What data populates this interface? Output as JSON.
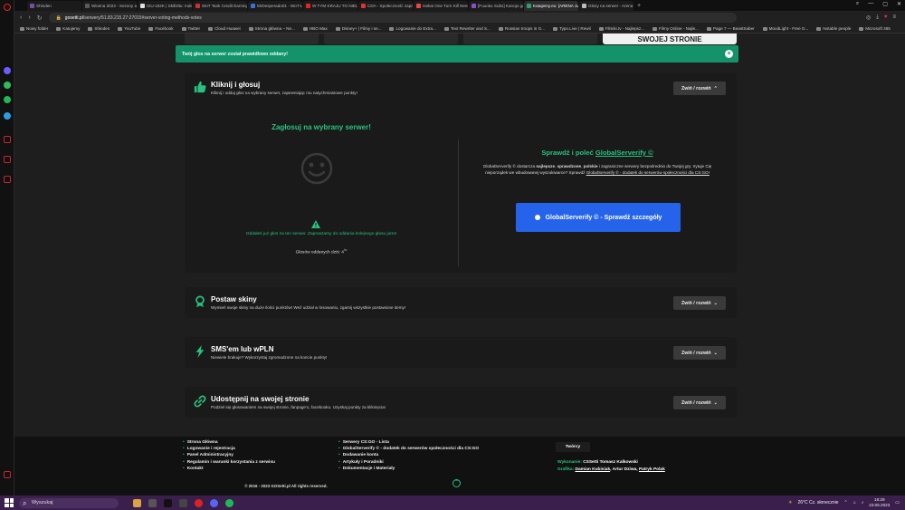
{
  "browser": {
    "tabs": [
      {
        "label": "Shinden",
        "color": "#7a4fa3"
      },
      {
        "label": "Wiosna 2023 - Sezony ani",
        "color": "#5a5a5a"
      },
      {
        "label": "ISU-152K | Skill4ltu: Index",
        "color": "#e0e0e0"
      },
      {
        "label": "WoT Tank Credit Earnings",
        "color": "#c83232"
      },
      {
        "label": "MrDesperado01 - WoT-Li",
        "color": "#3a6fd8"
      },
      {
        "label": "W TYM KRAJU TO NIELEGA",
        "color": "#e22"
      },
      {
        "label": "CDA - Społeczność zapal",
        "color": "#d33"
      },
      {
        "label": "Isekai One Turn Kill Neesa",
        "color": "#e44"
      },
      {
        "label": "[Fuuoku Subs] Kanojo ga",
        "color": "#8a4fc3"
      },
      {
        "label": "Katujemy.eu: [ARENA 1vs1]",
        "color": "#2aa36b"
      },
      {
        "label": "Głosy na serwer - Arena 1v",
        "color": "#bbb"
      }
    ],
    "active_tab": 9,
    "url_domain": "gosetti.pl",
    "url_path": "/serwery/51.83.215.27:27015#server-voting-methods-votes",
    "bookmarks": [
      "Nowy folder",
      "Katujemy",
      "Shinden",
      "YouTube",
      "Facebook",
      "Twitter",
      "Cloud Huawei",
      "Strona główna – Ne...",
      "HBO Max",
      "Disney+ | Filmy i se...",
      "Logowanie do Extra...",
      "Text Rewriter and S...",
      "Russian troops in G...",
      "Typo.Live | Rewil",
      "Filmiki.tv - Najlepsz...",
      "Filmy Online - Najle...",
      "Page 7 — BeastSaber",
      "MoodLight - Free G...",
      "Notable people",
      "Microsoft 365"
    ]
  },
  "page": {
    "peek_tabs": [
      "",
      "",
      "",
      "SWOJEJ STRONIE"
    ],
    "toast": {
      "text": "Twój głos na serwer został prawidłowo oddany!",
      "close": "×"
    },
    "collapse_label": "Zwiń / rozwiń",
    "vote_card": {
      "title": "Kliknij i głosuj",
      "subtitle": "Kliknij i oddaj głos na wybrany serwer, zapewniając mu natychmiastowe punkty!",
      "left_title": "Zagłosuj na wybrany serwer!",
      "already_voted": "Oddałeś już głos na ten serwer. Zapraszamy do oddania kolejnego głosu jutro!",
      "votes_today": "Głosów oddanych dziś: 4",
      "votes_today_sup": "/∞",
      "gs_title_prefix": "Sprawdź i poleć ",
      "gs_title_link": "GlobalServerify ©",
      "gs_desc_1": "GlobalServerify © dostarcza ",
      "gs_desc_b1": "najlepsze",
      "gs_desc_2": ", ",
      "gs_desc_b2": "sprawdzone",
      "gs_desc_3": ", ",
      "gs_desc_b3": "polskie",
      "gs_desc_4": " i zagraniczne serwery bezpośrednio do Twojej gry. Irytuje Cię nieporządek we wbudowanej wyszukiwarce? Sprawdź ",
      "gs_desc_link": "GlobalServerify © - dodatek do serwerów społeczności dla CS:GO!",
      "gs_button": "GlobalServerify © - Sprawdź szczegóły"
    },
    "skins_card": {
      "title": "Postaw skiny",
      "subtitle": "Wymień swoje skiny na duże ilości punktów! Weź udział w losowaniu, zgarnij wszystkie postawione itemy!"
    },
    "sms_card": {
      "title": "SMS'em lub wPLN",
      "subtitle": "Niewiele brakuje? Wykorzystaj zgromadzone na koncie punkty!"
    },
    "share_card": {
      "title": "Udostępnij na swojej stronie",
      "subtitle": "Podziel się głosowaniem na swojej stronie, fanpage'u, facebooku. Uzyskaj punkty za kliknięcia!"
    },
    "accent": "#27c27f"
  },
  "footer": {
    "col1": [
      "Strona Główna",
      "Logowanie i rejestracja",
      "Panel Administracyjny",
      "Regulamin i warunki korzystania z serwisu",
      "Kontakt"
    ],
    "col2": [
      "Serwery CS:GO - Lista",
      "GlobalServerify © - dodatek do serwerów społeczności dla CS:GO",
      "Dodawanie konta",
      "Artykuły i Poradniki",
      "Dokumentacje i Materiały"
    ],
    "authors_title": "Twórcy",
    "made_by_label": "Wykonanie:",
    "made_by": "CSSetti Tomasz Kalkowski",
    "graphics_label": "Grafika:",
    "graphics_1": "Damian Kubisiak",
    "graphics_sep1": ", Artur Dziwa, ",
    "graphics_2": "Patryk Polak",
    "copyright": "© 2016 - 2023 GOSetti.pl All rights reserved."
  },
  "taskbar": {
    "search_placeholder": "Wyszukaj",
    "weather": "26°C  Cz. słonecznie",
    "time": "16:29",
    "date": "23.05.2023"
  }
}
